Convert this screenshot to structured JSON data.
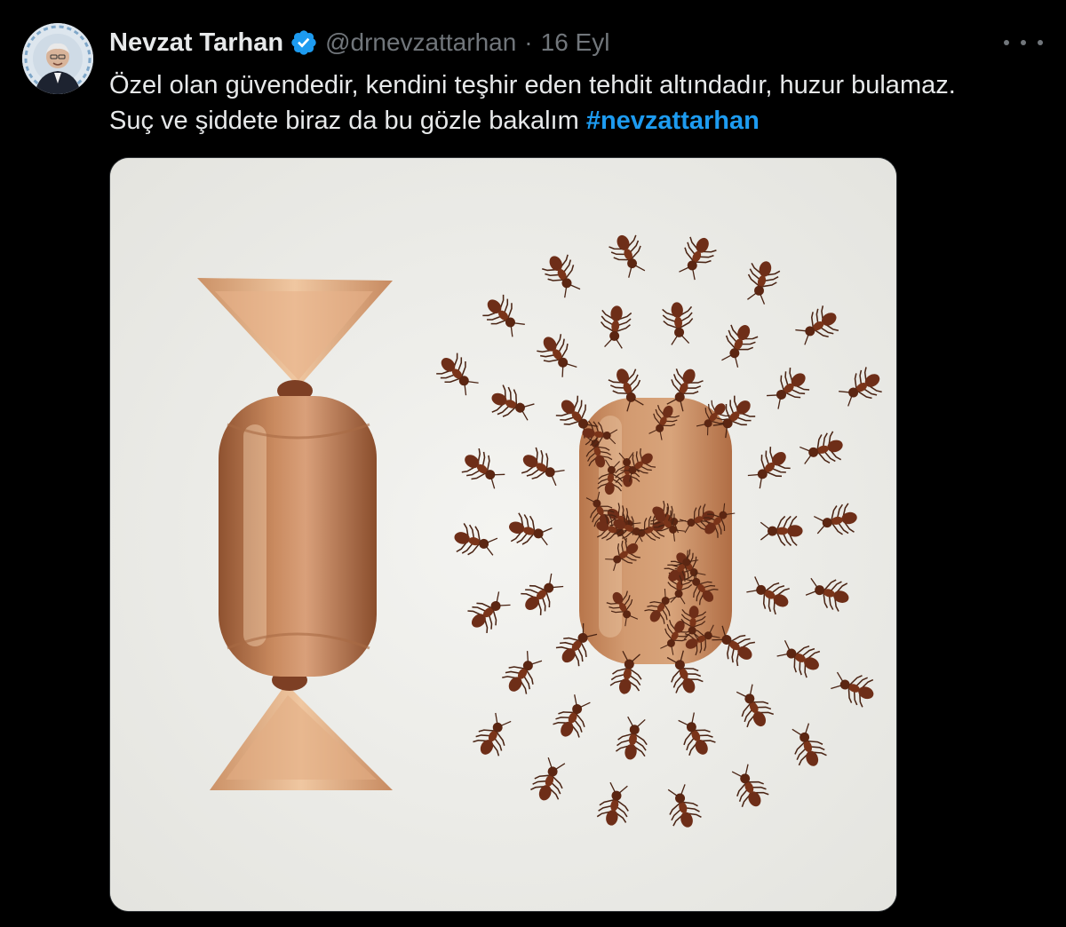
{
  "author": {
    "display_name": "Nevzat Tarhan",
    "handle": "@drnevzattarhan",
    "separator": "·",
    "date": "16 Eyl",
    "verified": true,
    "verified_color": "#1d9bf0",
    "avatar_icon": "profile-photo"
  },
  "tweet": {
    "line1": "Özel olan güvendedir, kendini teşhir eden tehdit altındadır, huzur bulamaz.",
    "line2_text": "Suç ve şiddete biraz da bu gözle bakalım ",
    "hashtag": "#nevzattarhan"
  },
  "media": {
    "kind": "photo",
    "subject": "wrapped candy beside an unwrapped candy covered in ants"
  },
  "colors": {
    "background": "#000000",
    "text": "#e7e9ea",
    "muted": "#71767b",
    "link": "#1d9bf0"
  },
  "icons": {
    "more": "more-horizontal-icon",
    "verified": "verified-badge-icon"
  }
}
